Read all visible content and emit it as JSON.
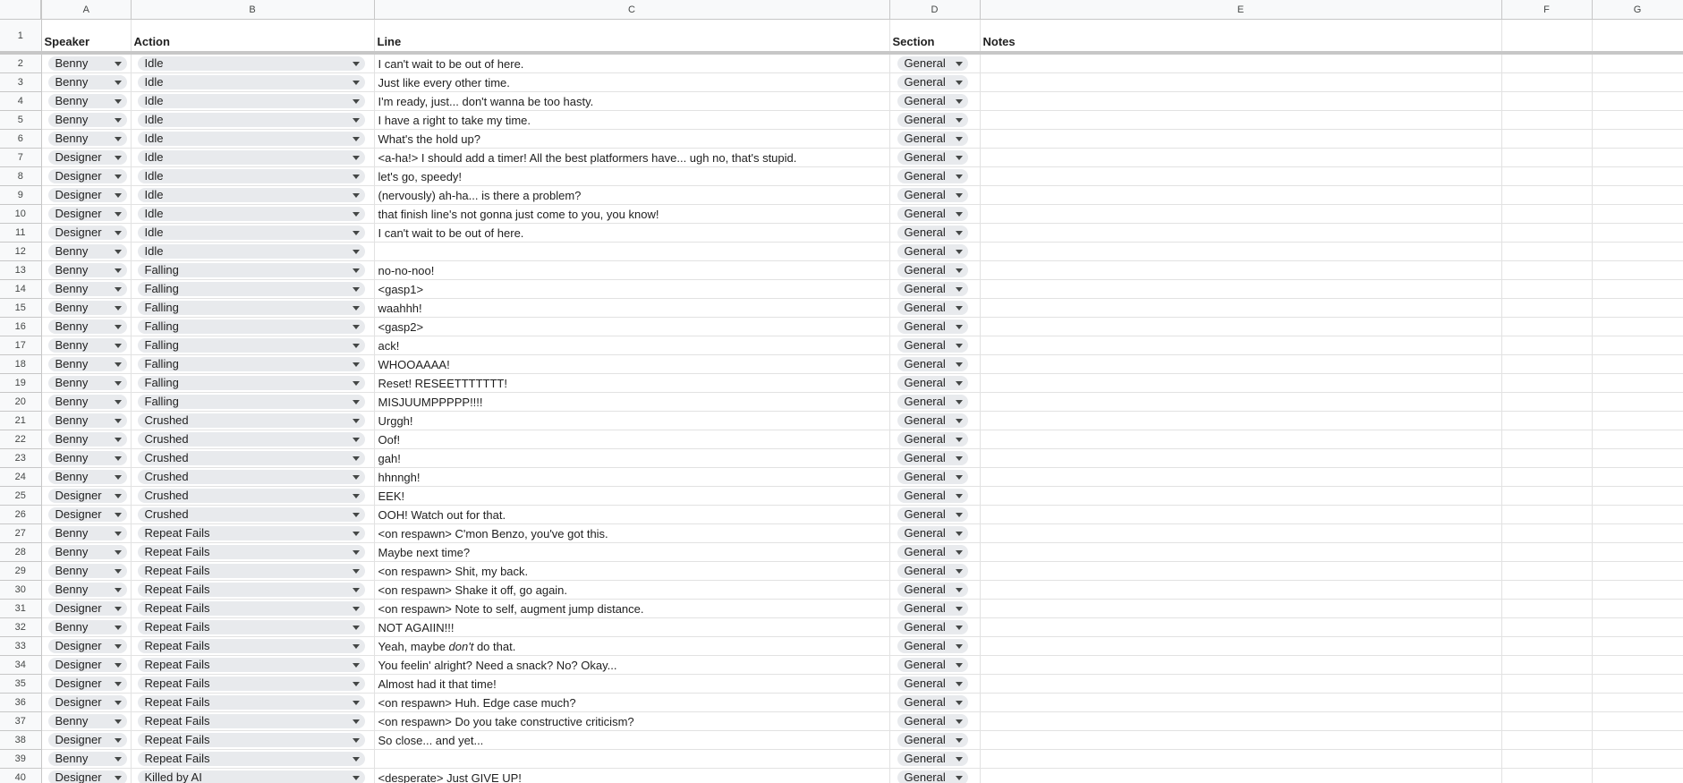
{
  "columns": [
    "A",
    "B",
    "C",
    "D",
    "E",
    "F",
    "G"
  ],
  "header_row": {
    "num": "1",
    "speaker": "Speaker",
    "action": "Action",
    "line": "Line",
    "section": "Section",
    "notes": "Notes"
  },
  "rows": [
    {
      "n": "2",
      "speaker": "Benny",
      "action": "Idle",
      "line": "I can't wait to be out of here.",
      "section": "General"
    },
    {
      "n": "3",
      "speaker": "Benny",
      "action": "Idle",
      "line": "Just like every other time.",
      "section": "General"
    },
    {
      "n": "4",
      "speaker": "Benny",
      "action": "Idle",
      "line": "I'm ready, just... don't wanna be too hasty.",
      "section": "General"
    },
    {
      "n": "5",
      "speaker": "Benny",
      "action": "Idle",
      "line": "I have a right to take my time.",
      "section": "General"
    },
    {
      "n": "6",
      "speaker": "Benny",
      "action": "Idle",
      "line": "What's the hold up?",
      "section": "General"
    },
    {
      "n": "7",
      "speaker": "Designer",
      "action": "Idle",
      "line": "<a-ha!> I should add a timer! All the best platformers have... ugh no, that's stupid.",
      "section": "General"
    },
    {
      "n": "8",
      "speaker": "Designer",
      "action": "Idle",
      "line": "let's go, speedy!",
      "section": "General"
    },
    {
      "n": "9",
      "speaker": "Designer",
      "action": "Idle",
      "line": "(nervously) ah-ha... is there a problem?",
      "section": "General"
    },
    {
      "n": "10",
      "speaker": "Designer",
      "action": "Idle",
      "line": "that finish line's not gonna just come to you, you know!",
      "section": "General"
    },
    {
      "n": "11",
      "speaker": "Designer",
      "action": "Idle",
      "line": "I can't wait to be out of here.",
      "section": "General"
    },
    {
      "n": "12",
      "speaker": "Benny",
      "action": "Idle",
      "line": "",
      "section": "General"
    },
    {
      "n": "13",
      "speaker": "Benny",
      "action": "Falling",
      "line": "no-no-noo!",
      "section": "General"
    },
    {
      "n": "14",
      "speaker": "Benny",
      "action": "Falling",
      "line": "<gasp1>",
      "section": "General"
    },
    {
      "n": "15",
      "speaker": "Benny",
      "action": "Falling",
      "line": "waahhh!",
      "section": "General"
    },
    {
      "n": "16",
      "speaker": "Benny",
      "action": "Falling",
      "line": "<gasp2>",
      "section": "General"
    },
    {
      "n": "17",
      "speaker": "Benny",
      "action": "Falling",
      "line": "ack!",
      "section": "General"
    },
    {
      "n": "18",
      "speaker": "Benny",
      "action": "Falling",
      "line": "WHOOAAAA!",
      "section": "General"
    },
    {
      "n": "19",
      "speaker": "Benny",
      "action": "Falling",
      "line": "Reset! RESEETTTTTTT!",
      "section": "General"
    },
    {
      "n": "20",
      "speaker": "Benny",
      "action": "Falling",
      "line": "MISJUUMPPPPP!!!!",
      "section": "General"
    },
    {
      "n": "21",
      "speaker": "Benny",
      "action": "Crushed",
      "line": "Urggh!",
      "section": "General"
    },
    {
      "n": "22",
      "speaker": "Benny",
      "action": "Crushed",
      "line": "Oof!",
      "section": "General"
    },
    {
      "n": "23",
      "speaker": "Benny",
      "action": "Crushed",
      "line": "gah!",
      "section": "General"
    },
    {
      "n": "24",
      "speaker": "Benny",
      "action": "Crushed",
      "line": "hhnngh!",
      "section": "General"
    },
    {
      "n": "25",
      "speaker": "Designer",
      "action": "Crushed",
      "line": "EEK!",
      "section": "General"
    },
    {
      "n": "26",
      "speaker": "Designer",
      "action": "Crushed",
      "line": "OOH! Watch out for that.",
      "section": "General"
    },
    {
      "n": "27",
      "speaker": "Benny",
      "action": "Repeat Fails",
      "line": "<on respawn> C'mon Benzo, you've got this.",
      "section": "General"
    },
    {
      "n": "28",
      "speaker": "Benny",
      "action": "Repeat Fails",
      "line": "Maybe next time?",
      "section": "General"
    },
    {
      "n": "29",
      "speaker": "Benny",
      "action": "Repeat Fails",
      "line": "<on respawn> Shit, my back.",
      "section": "General"
    },
    {
      "n": "30",
      "speaker": "Benny",
      "action": "Repeat Fails",
      "line": "<on respawn> Shake it off, go again.",
      "section": "General"
    },
    {
      "n": "31",
      "speaker": "Designer",
      "action": "Repeat Fails",
      "line": " <on respawn> Note to self, augment jump distance.",
      "section": "General"
    },
    {
      "n": "32",
      "speaker": "Benny",
      "action": "Repeat Fails",
      "line": "NOT AGAIIN!!!",
      "section": "General"
    },
    {
      "n": "33",
      "speaker": "Designer",
      "action": "Repeat Fails",
      "line": "Yeah, maybe don't do that.",
      "section": "General"
    },
    {
      "n": "34",
      "speaker": "Designer",
      "action": "Repeat Fails",
      "line": "You feelin' alright? Need a snack? No? Okay...",
      "section": "General"
    },
    {
      "n": "35",
      "speaker": "Designer",
      "action": "Repeat Fails",
      "line": "Almost had it that time!",
      "section": "General"
    },
    {
      "n": "36",
      "speaker": "Designer",
      "action": "Repeat Fails",
      "line": "<on respawn> Huh. Edge case much?",
      "section": "General"
    },
    {
      "n": "37",
      "speaker": "Benny",
      "action": "Repeat Fails",
      "line": "<on respawn> Do you take constructive criticism?",
      "section": "General"
    },
    {
      "n": "38",
      "speaker": "Designer",
      "action": "Repeat Fails",
      "line": "So close... and yet...",
      "section": "General"
    },
    {
      "n": "39",
      "speaker": "Benny",
      "action": "Repeat Fails",
      "line": "",
      "section": "General"
    },
    {
      "n": "40",
      "speaker": "Designer",
      "action": "Killed by AI",
      "line": "<desperate> Just GIVE UP!",
      "section": "General"
    }
  ]
}
